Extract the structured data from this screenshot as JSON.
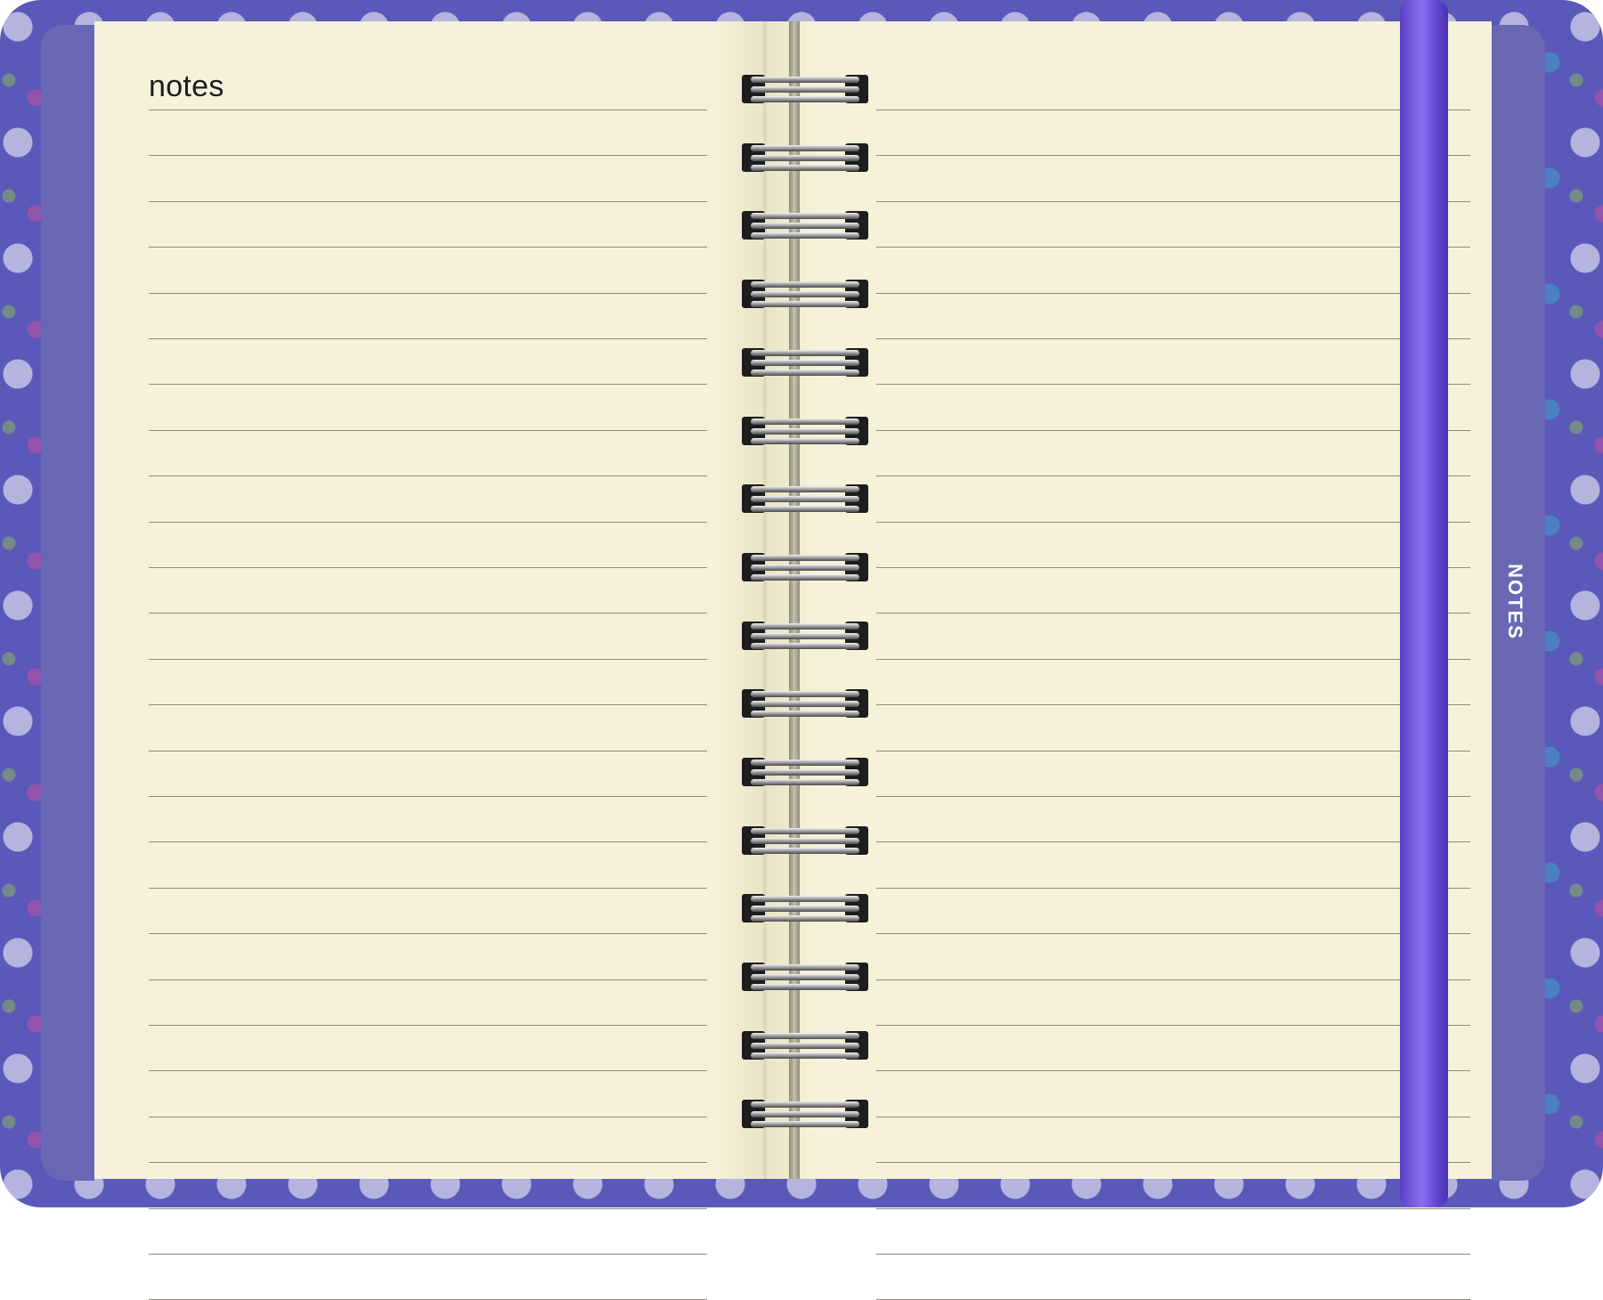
{
  "notebook": {
    "page_heading": "notes",
    "section_tab_label": "NOTES",
    "colors": {
      "cover_accent": "#5a58b8",
      "side_band": "#6a68b4",
      "page": "#f6f2d9",
      "rule_line": "#8c8a80",
      "elastic_band": "#7a5ee0",
      "binding_wire": "#c8c8c8"
    }
  }
}
